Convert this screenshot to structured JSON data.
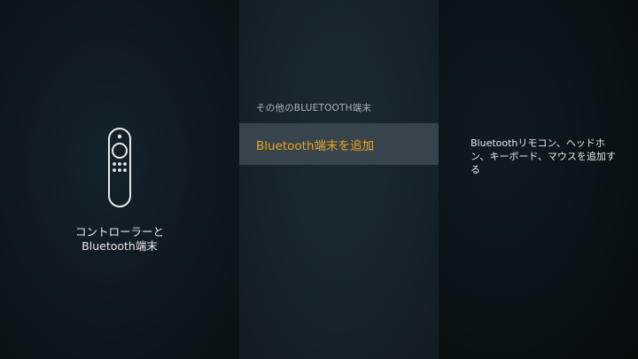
{
  "left_panel": {
    "icon": "fire-tv-remote-icon",
    "label_line1": "コントローラーと",
    "label_line2": "Bluetooth端末"
  },
  "middle_panel": {
    "section_header": "その他のBLUETOOTH端末",
    "items": [
      {
        "label": "Bluetooth端末を追加",
        "selected": true
      }
    ]
  },
  "right_panel": {
    "description": "Bluetoothリモコン、ヘッドホン、キーボード、マウスを追加する"
  },
  "colors": {
    "accent": "#f0a420",
    "selected_row": "#37444b",
    "text": "#e6e9eb",
    "muted_text": "#aab3b8"
  }
}
